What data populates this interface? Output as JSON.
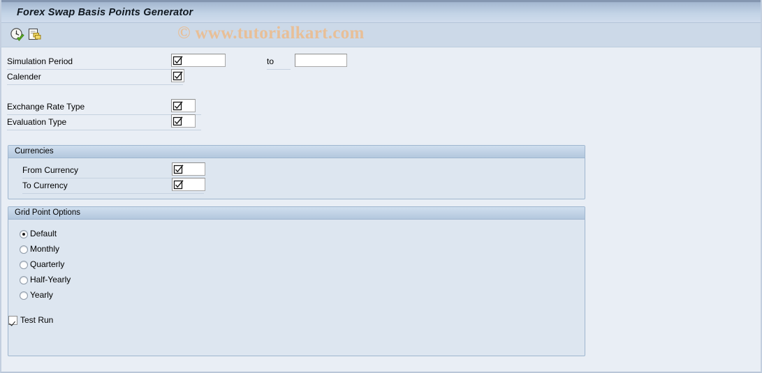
{
  "window": {
    "title": "Forex Swap Basis Points Generator"
  },
  "watermark": {
    "text": "© www.tutorialkart.com",
    "color": "#e8bf97"
  },
  "toolbar": {
    "icons": [
      {
        "name": "execute-clock-icon",
        "tooltip": "Execute"
      },
      {
        "name": "copy-variant-icon",
        "tooltip": "Get Variant"
      }
    ]
  },
  "theme": {
    "background": "#e9eef5",
    "titlebar_gradient_top": "#9eb2cb",
    "titlebar_gradient_bottom": "#cfdcec",
    "toolbar_background": "#ccd9e8",
    "group_background": "#dde6f0",
    "group_border": "#9fb6cf",
    "field_border": "#8e8e8e",
    "label_underline": "#c6d2e0"
  },
  "form": {
    "rows": [
      {
        "label": "Simulation Period",
        "value": "",
        "placeholder": "",
        "has_match_code": true
      },
      {
        "label": "Calender",
        "value": "",
        "placeholder": "",
        "has_match_code": true
      },
      {
        "label": "Exchange Rate Type",
        "value": "",
        "placeholder": "",
        "has_match_code": true
      },
      {
        "label": "Evaluation Type",
        "value": "",
        "placeholder": "",
        "has_match_code": true
      }
    ],
    "range": {
      "to_label": "to",
      "to_value": "",
      "to_placeholder": ""
    }
  },
  "currencies_group": {
    "title": "Currencies",
    "rows": [
      {
        "label": "From Currency",
        "value": "",
        "placeholder": "",
        "has_match_code": true
      },
      {
        "label": "To Currency",
        "value": "",
        "placeholder": "",
        "has_match_code": true
      }
    ]
  },
  "grid_point_options": {
    "title": "Grid Point Options",
    "selected": "Default",
    "options": [
      {
        "label": "Default",
        "checked": true
      },
      {
        "label": "Monthly",
        "checked": false
      },
      {
        "label": "Quarterly",
        "checked": false
      },
      {
        "label": "Half-Yearly",
        "checked": false
      },
      {
        "label": "Yearly",
        "checked": false
      }
    ]
  },
  "test_run": {
    "label": "Test Run",
    "checked": true
  }
}
